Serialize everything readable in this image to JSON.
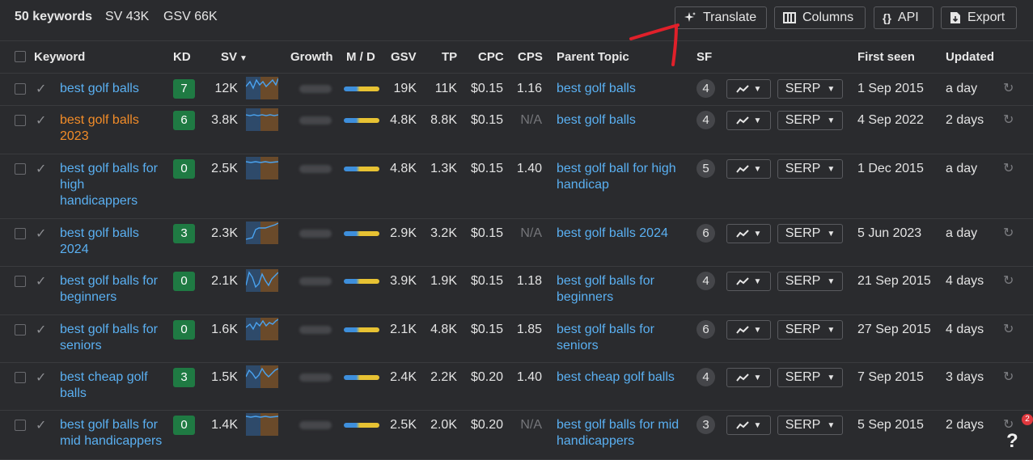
{
  "summary": {
    "keywords": "50 keywords",
    "sv": "SV 43K",
    "gsv": "GSV 66K"
  },
  "toolbar": {
    "translate": "Translate",
    "columns": "Columns",
    "api": "API",
    "export": "Export"
  },
  "columns": [
    "Keyword",
    "KD",
    "SV",
    "Growth",
    "M / D",
    "GSV",
    "TP",
    "CPC",
    "CPS",
    "Parent Topic",
    "SF",
    "First seen",
    "Updated"
  ],
  "rows": [
    {
      "keyword": "best golf balls",
      "kd": "7",
      "sv": "12K",
      "gsv": "19K",
      "tp": "11K",
      "cpc": "$0.15",
      "cps": "1.16",
      "parent": "best golf balls",
      "sf": "4",
      "serp": "SERP",
      "first_seen": "1 Sep 2015",
      "updated": "a day",
      "highlight": false
    },
    {
      "keyword": "best golf balls 2023",
      "kd": "6",
      "sv": "3.8K",
      "gsv": "4.8K",
      "tp": "8.8K",
      "cpc": "$0.15",
      "cps": "N/A",
      "parent": "best golf balls",
      "sf": "4",
      "serp": "SERP",
      "first_seen": "4 Sep 2022",
      "updated": "2 days",
      "highlight": true
    },
    {
      "keyword": "best golf balls for high handicappers",
      "kd": "0",
      "sv": "2.5K",
      "gsv": "4.8K",
      "tp": "1.3K",
      "cpc": "$0.15",
      "cps": "1.40",
      "parent": "best golf ball for high handicap",
      "sf": "5",
      "serp": "SERP",
      "first_seen": "1 Dec 2015",
      "updated": "a day",
      "highlight": false
    },
    {
      "keyword": "best golf balls 2024",
      "kd": "3",
      "sv": "2.3K",
      "gsv": "2.9K",
      "tp": "3.2K",
      "cpc": "$0.15",
      "cps": "N/A",
      "parent": "best golf balls 2024",
      "sf": "6",
      "serp": "SERP",
      "first_seen": "5 Jun 2023",
      "updated": "a day",
      "highlight": false
    },
    {
      "keyword": "best golf balls for beginners",
      "kd": "0",
      "sv": "2.1K",
      "gsv": "3.9K",
      "tp": "1.9K",
      "cpc": "$0.15",
      "cps": "1.18",
      "parent": "best golf balls for beginners",
      "sf": "4",
      "serp": "SERP",
      "first_seen": "21 Sep 2015",
      "updated": "4 days",
      "highlight": false
    },
    {
      "keyword": "best golf balls for seniors",
      "kd": "0",
      "sv": "1.6K",
      "gsv": "2.1K",
      "tp": "4.8K",
      "cpc": "$0.15",
      "cps": "1.85",
      "parent": "best golf balls for seniors",
      "sf": "6",
      "serp": "SERP",
      "first_seen": "27 Sep 2015",
      "updated": "4 days",
      "highlight": false
    },
    {
      "keyword": "best cheap golf balls",
      "kd": "3",
      "sv": "1.5K",
      "gsv": "2.4K",
      "tp": "2.2K",
      "cpc": "$0.20",
      "cps": "1.40",
      "parent": "best cheap golf balls",
      "sf": "4",
      "serp": "SERP",
      "first_seen": "7 Sep 2015",
      "updated": "3 days",
      "highlight": false
    },
    {
      "keyword": "best golf balls for mid handicappers",
      "kd": "0",
      "sv": "1.4K",
      "gsv": "2.5K",
      "tp": "2.0K",
      "cpc": "$0.20",
      "cps": "N/A",
      "parent": "best golf balls for mid handicappers",
      "sf": "3",
      "serp": "SERP",
      "first_seen": "5 Sep 2015",
      "updated": "2 days",
      "highlight": false
    }
  ],
  "notification_count": "2",
  "help": "?",
  "colors": {
    "link": "#5ab0f2",
    "highlight": "#f28c28",
    "kd_badge": "#1f7a43",
    "background": "#2a2b2e"
  },
  "icons": {
    "translate": "sparkle-icon",
    "columns": "columns-icon",
    "api": "braces-icon",
    "export": "download-icon",
    "row_check": "check-icon",
    "trend": "trend-icon",
    "refresh": "refresh-icon"
  }
}
